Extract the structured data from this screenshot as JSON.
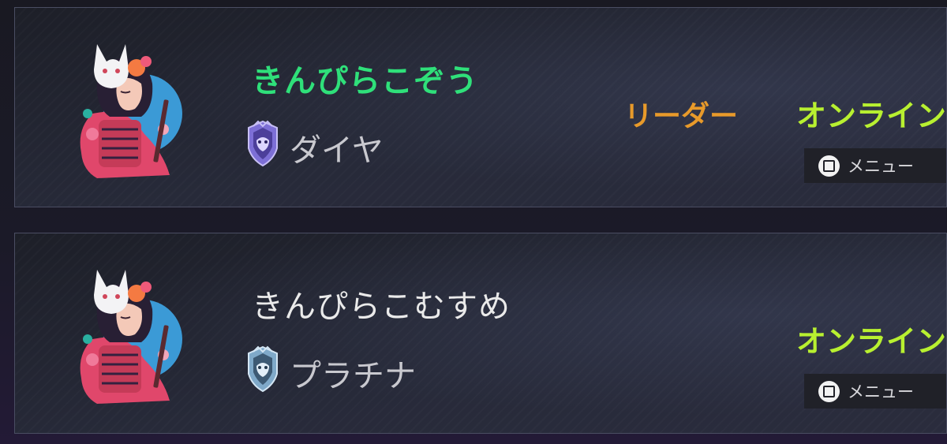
{
  "colors": {
    "leader_name": "#2fe07a",
    "member_name": "#eaeaea",
    "role_badge": "#e89a2a",
    "status_online": "#b8f030",
    "rank_text": "#c9c9cf",
    "diamond_rank": "#9b8ce8",
    "platinum_rank": "#9cc3e2"
  },
  "members": [
    {
      "name": "きんぴらこぞう",
      "rank": "ダイヤ",
      "rank_icon": "diamond-rank-icon",
      "role": "リーダー",
      "status": "オンライン",
      "menu_label": "メニュー",
      "menu_icon": "square-button-icon",
      "avatar": "kitsune-girl-avatar"
    },
    {
      "name": "きんぴらこむすめ",
      "rank": "プラチナ",
      "rank_icon": "platinum-rank-icon",
      "role": "",
      "status": "オンライン",
      "menu_label": "メニュー",
      "menu_icon": "square-button-icon",
      "avatar": "kitsune-girl-avatar"
    }
  ]
}
